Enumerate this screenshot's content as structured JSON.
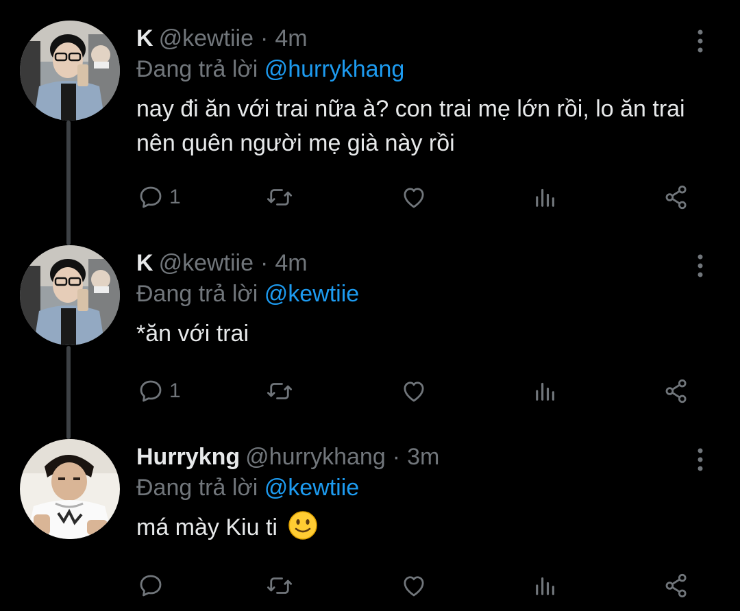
{
  "tweets": [
    {
      "display_name": "K",
      "handle": "@kewtiie",
      "dot": "·",
      "time": "4m",
      "replying_label": "Đang trả lời",
      "replying_to": "@hurrykhang",
      "text": "nay đi ăn với trai nữa à? con trai mẹ lớn rồi, lo ăn trai nên quên người mẹ già này rồi",
      "reply_count": "1",
      "avatar_icon": "profile-photo-k"
    },
    {
      "display_name": "K",
      "handle": "@kewtiie",
      "dot": "·",
      "time": "4m",
      "replying_label": "Đang trả lời",
      "replying_to": "@kewtiie",
      "text": "*ăn với trai",
      "reply_count": "1",
      "avatar_icon": "profile-photo-k"
    },
    {
      "display_name": "Hurrykng",
      "handle": "@hurrykhang",
      "dot": "·",
      "time": "3m",
      "replying_label": "Đang trả lời",
      "replying_to": "@kewtiie",
      "text": "má mày Kiu ti",
      "reply_count": "",
      "avatar_icon": "profile-photo-hurrykng",
      "emoji": "slightly-smiling-face-emoji"
    }
  ],
  "icons": {
    "reply": "reply-icon",
    "retweet": "retweet-icon",
    "like": "heart-icon",
    "views": "analytics-icon",
    "share": "share-icon",
    "more": "more-vertical-icon"
  },
  "colors": {
    "background": "#000000",
    "text": "#e7e9ea",
    "secondary": "#71767b",
    "mention": "#1d9bf0",
    "thread_line": "#3d4145"
  }
}
